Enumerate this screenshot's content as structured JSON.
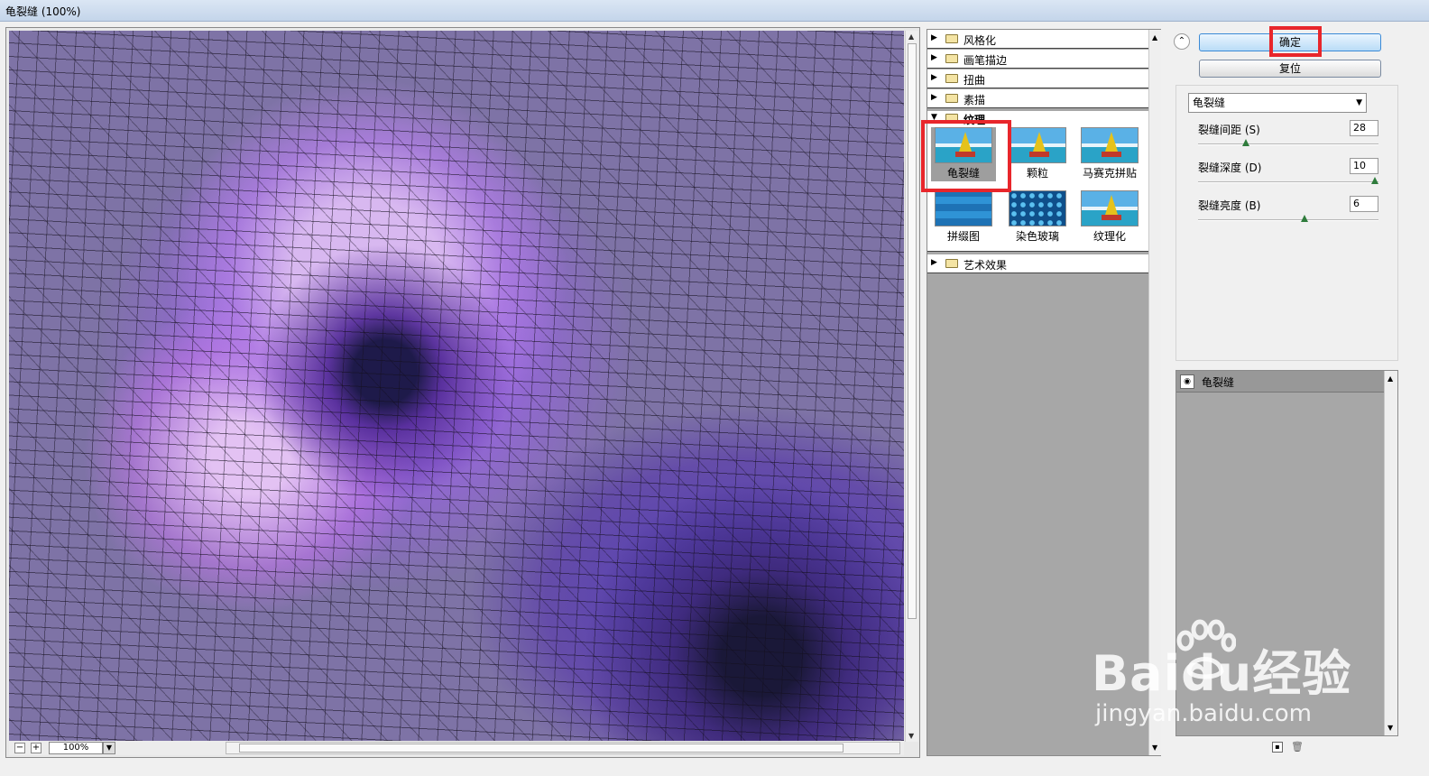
{
  "window": {
    "title": "龟裂缝 (100%)"
  },
  "preview": {
    "zoom": "100%",
    "zoom_out": "−",
    "zoom_in": "+"
  },
  "gallery": {
    "categories": [
      "风格化",
      "画笔描边",
      "扭曲",
      "素描"
    ],
    "expanded_category": "纹理",
    "filters": [
      "龟裂缝",
      "颗粒",
      "马赛克拼贴",
      "拼缀图",
      "染色玻璃",
      "纹理化"
    ],
    "selected_filter": "龟裂缝",
    "after_category": "艺术效果"
  },
  "buttons": {
    "ok": "确定",
    "reset": "复位"
  },
  "settings": {
    "filter_select": "龟裂缝",
    "params": [
      {
        "label": "裂缝间距 (S)",
        "value": "28",
        "fraction": 0.27
      },
      {
        "label": "裂缝深度 (D)",
        "value": "10",
        "fraction": 1.0
      },
      {
        "label": "裂缝亮度 (B)",
        "value": "6",
        "fraction": 0.6
      }
    ]
  },
  "layers": {
    "items": [
      "龟裂缝"
    ]
  },
  "watermark": {
    "brand": "Baidu经验",
    "url": "jingyan.baidu.com"
  },
  "colors": {
    "highlight_box": "#e8262b",
    "ok_button": "#b9dcf7"
  }
}
